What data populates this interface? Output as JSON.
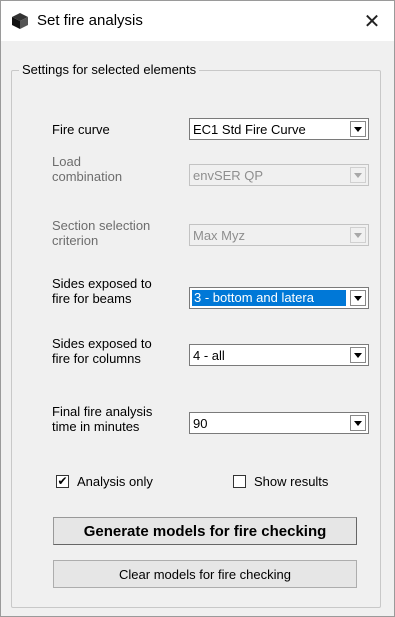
{
  "window": {
    "title": "Set fire analysis",
    "close_label": "✕"
  },
  "group": {
    "label": "Settings for selected elements"
  },
  "fields": {
    "fire_curve": {
      "label": "Fire curve",
      "value": "EC1 Std Fire Curve"
    },
    "load_combination": {
      "label_line1": "Load",
      "label_line2": "combination",
      "value": "envSER QP"
    },
    "section_selection": {
      "label_line1": "Section selection",
      "label_line2": "criterion",
      "value": "Max Myz"
    },
    "sides_beams": {
      "label_line1": "Sides exposed to",
      "label_line2": "fire for beams",
      "value": "3 - bottom and latera"
    },
    "sides_columns": {
      "label_line1": "Sides exposed to",
      "label_line2": "fire for columns",
      "value": "4 - all"
    },
    "final_time": {
      "label_line1": "Final fire analysis",
      "label_line2": "time in minutes",
      "value": "90"
    }
  },
  "checkboxes": {
    "analysis_only": {
      "label": "Analysis only",
      "checked": true,
      "mark": "✔"
    },
    "show_results": {
      "label": "Show results",
      "checked": false
    }
  },
  "buttons": {
    "generate": "Generate models for fire checking",
    "clear": "Clear models for fire checking"
  },
  "icons": {
    "app": "cube-icon",
    "close": "close-icon",
    "dropdown": "chevron-down-icon"
  }
}
